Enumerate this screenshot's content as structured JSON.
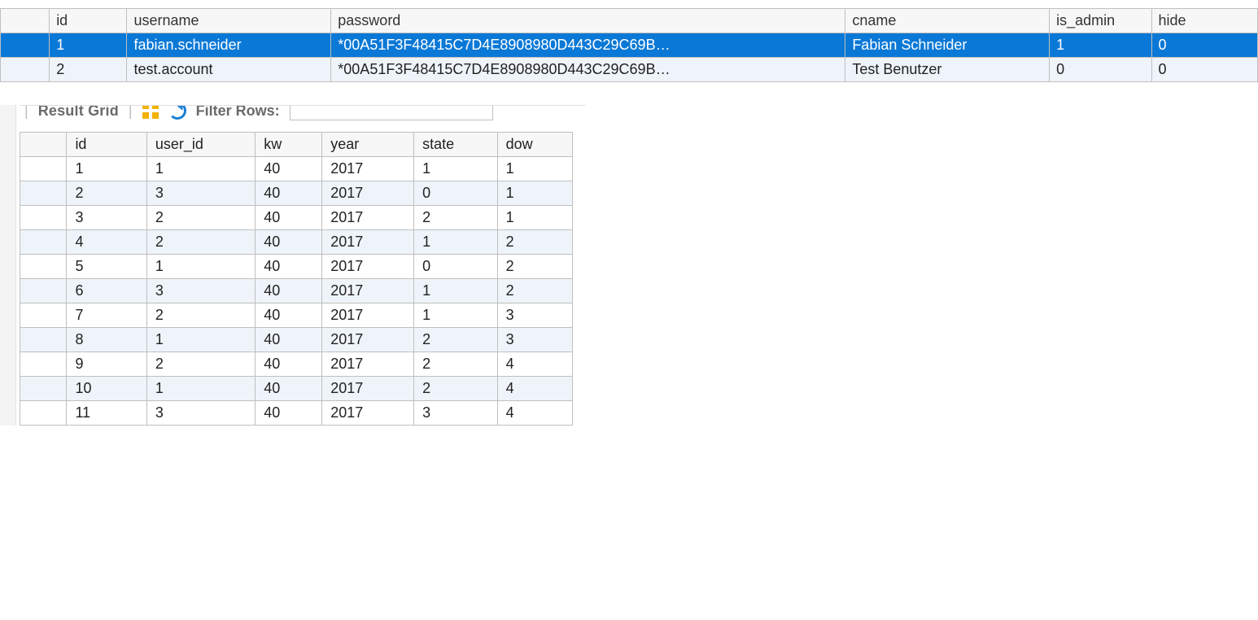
{
  "top_table": {
    "columns": [
      "id",
      "username",
      "password",
      "cname",
      "is_admin",
      "hide"
    ],
    "rows": [
      {
        "selected": true,
        "id": "1",
        "username": "fabian.schneider",
        "password": "*00A51F3F48415C7D4E8908980D443C29C69B…",
        "cname": "Fabian Schneider",
        "is_admin": "1",
        "hide": "0"
      },
      {
        "selected": false,
        "id": "2",
        "username": "test.account",
        "password": "*00A51F3F48415C7D4E8908980D443C29C69B…",
        "cname": "Test Benutzer",
        "is_admin": "0",
        "hide": "0"
      }
    ]
  },
  "toolbar": {
    "result_grid_label": "Result Grid",
    "filter_label": "Filter Rows:",
    "filter_value": ""
  },
  "bottom_table": {
    "columns": [
      "id",
      "user_id",
      "kw",
      "year",
      "state",
      "dow"
    ],
    "rows": [
      {
        "id": "1",
        "user_id": "1",
        "kw": "40",
        "year": "2017",
        "state": "1",
        "dow": "1"
      },
      {
        "id": "2",
        "user_id": "3",
        "kw": "40",
        "year": "2017",
        "state": "0",
        "dow": "1"
      },
      {
        "id": "3",
        "user_id": "2",
        "kw": "40",
        "year": "2017",
        "state": "2",
        "dow": "1"
      },
      {
        "id": "4",
        "user_id": "2",
        "kw": "40",
        "year": "2017",
        "state": "1",
        "dow": "2"
      },
      {
        "id": "5",
        "user_id": "1",
        "kw": "40",
        "year": "2017",
        "state": "0",
        "dow": "2"
      },
      {
        "id": "6",
        "user_id": "3",
        "kw": "40",
        "year": "2017",
        "state": "1",
        "dow": "2"
      },
      {
        "id": "7",
        "user_id": "2",
        "kw": "40",
        "year": "2017",
        "state": "1",
        "dow": "3"
      },
      {
        "id": "8",
        "user_id": "1",
        "kw": "40",
        "year": "2017",
        "state": "2",
        "dow": "3"
      },
      {
        "id": "9",
        "user_id": "2",
        "kw": "40",
        "year": "2017",
        "state": "2",
        "dow": "4"
      },
      {
        "id": "10",
        "user_id": "1",
        "kw": "40",
        "year": "2017",
        "state": "2",
        "dow": "4"
      },
      {
        "id": "11",
        "user_id": "3",
        "kw": "40",
        "year": "2017",
        "state": "3",
        "dow": "4"
      }
    ]
  }
}
